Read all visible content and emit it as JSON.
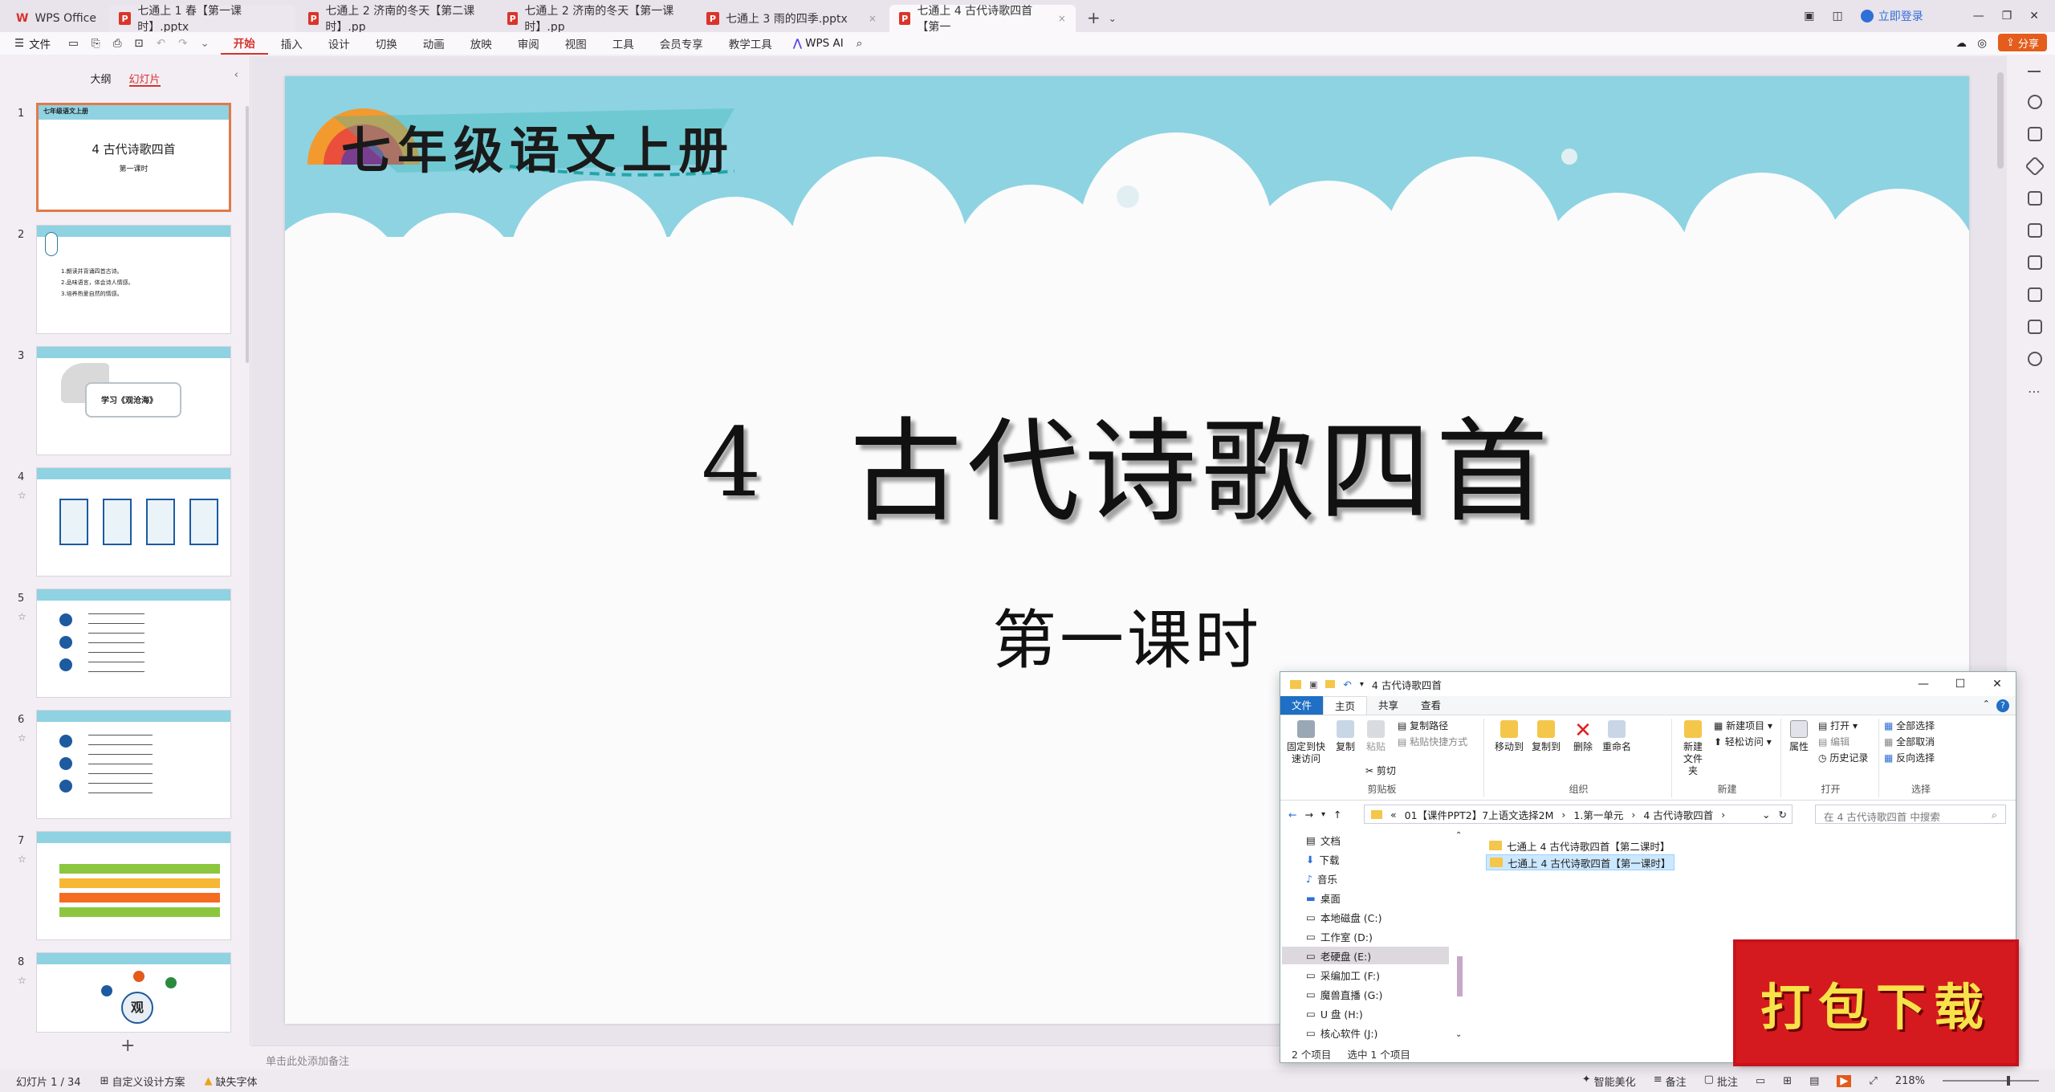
{
  "tabs": [
    {
      "label": "WPS Office",
      "kind": "home"
    },
    {
      "label": "七通上 1 春【第一课时】.pptx",
      "kind": "ppt"
    },
    {
      "label": "七通上 2 济南的冬天【第二课时】.pp",
      "kind": "ppt"
    },
    {
      "label": "七通上 2 济南的冬天【第一课时】.pp",
      "kind": "ppt"
    },
    {
      "label": "七通上 3 雨的四季.pptx",
      "kind": "ppt"
    },
    {
      "label": "七通上 4 古代诗歌四首【第一",
      "kind": "ppt",
      "active": true
    }
  ],
  "titlebar": {
    "login": "立即登录"
  },
  "ribbon": {
    "file": "文件",
    "menus": [
      "开始",
      "插入",
      "设计",
      "切换",
      "动画",
      "放映",
      "审阅",
      "视图",
      "工具",
      "会员专享",
      "教学工具"
    ],
    "active": "开始",
    "ai": "WPS AI",
    "share": "分享"
  },
  "panel": {
    "outline": "大纲",
    "slides": "幻灯片"
  },
  "thumbs": [
    {
      "num": "1",
      "title": "4  古代诗歌四首",
      "sub": "第一课时",
      "header": "七年级语文上册"
    },
    {
      "num": "2",
      "lines": [
        "1.朗读并背诵四首古诗。",
        "2.品味语言，体会诗人情感。",
        "3.培养热爱自然的情感。"
      ]
    },
    {
      "num": "3",
      "title": "学习《观沧海》"
    },
    {
      "num": "4"
    },
    {
      "num": "5"
    },
    {
      "num": "6"
    },
    {
      "num": "7"
    },
    {
      "num": "8",
      "title": "观"
    }
  ],
  "slide": {
    "banner": "七年级语文上册",
    "number": "4",
    "title": "古代诗歌四首",
    "subtitle": "第一课时"
  },
  "notes_placeholder": "单击此处添加备注",
  "status": {
    "slide": "幻灯片 1 / 34",
    "design": "自定义设计方案",
    "font": "缺失字体",
    "beautify": "智能美化",
    "notes": "备注",
    "comment": "批注",
    "zoom": "218%"
  },
  "explorer": {
    "title": "4 古代诗歌四首",
    "tabs": [
      "文件",
      "主页",
      "共享",
      "查看"
    ],
    "groups": {
      "clipboard": {
        "label": "剪贴板",
        "pin": "固定到快速访问",
        "copy": "复制",
        "paste": "粘贴",
        "copy_path": "复制路径",
        "paste_shortcut": "粘贴快捷方式",
        "cut": "剪切"
      },
      "organize": {
        "label": "组织",
        "move": "移动到",
        "copyto": "复制到",
        "delete": "删除",
        "rename": "重命名"
      },
      "new": {
        "label": "新建",
        "folder": "新建文件夹",
        "item": "新建项目",
        "easy": "轻松访问"
      },
      "open": {
        "label": "打开",
        "props": "属性",
        "open": "打开",
        "edit": "编辑",
        "history": "历史记录"
      },
      "select": {
        "label": "选择",
        "all": "全部选择",
        "none": "全部取消",
        "invert": "反向选择"
      }
    },
    "breadcrumb": [
      "01【课件PPT2】7上语文选择2M",
      "1.第一单元",
      "4 古代诗歌四首"
    ],
    "search_placeholder": "在 4 古代诗歌四首 中搜索",
    "nav": [
      "文档",
      "下载",
      "音乐",
      "桌面",
      "本地磁盘 (C:)",
      "工作室 (D:)",
      "老硬盘 (E:)",
      "采编加工 (F:)",
      "魔兽直播 (G:)",
      "U 盘 (H:)",
      "核心软件 (J:)"
    ],
    "nav_selected": "老硬盘 (E:)",
    "files": [
      "七通上 4 古代诗歌四首【第二课时】",
      "七通上 4 古代诗歌四首【第一课时】"
    ],
    "selected_file": "七通上 4 古代诗歌四首【第一课时】",
    "status_count": "2 个项目",
    "status_selected": "选中 1 个项目"
  },
  "promo": "打包下载"
}
